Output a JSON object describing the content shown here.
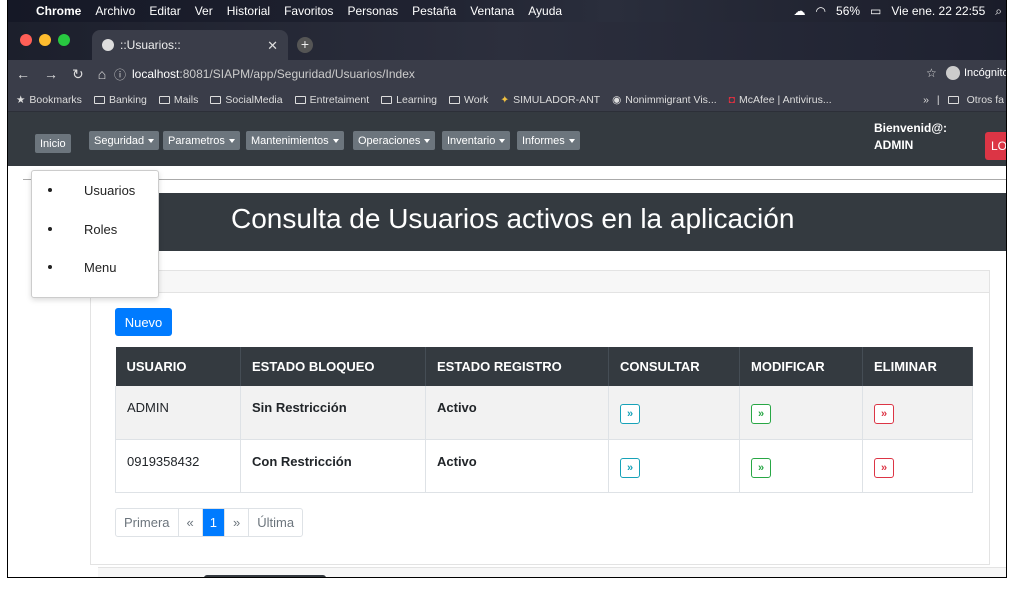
{
  "mac_menubar": {
    "app": "Chrome",
    "items": [
      "Archivo",
      "Editar",
      "Ver",
      "Historial",
      "Favoritos",
      "Personas",
      "Pestaña",
      "Ventana",
      "Ayuda"
    ],
    "battery": "56%",
    "datetime": "Vie ene. 22  22:55"
  },
  "browser": {
    "tab_title": "::Usuarios::",
    "url_host": "localhost",
    "url_rest": ":8081/SIAPM/app/Seguridad/Usuarios/Index",
    "profile": "Incógnito",
    "bookmarks": [
      {
        "label": "Bookmarks",
        "icon": "star-icon"
      },
      {
        "label": "Banking",
        "icon": "folder-icon"
      },
      {
        "label": "Mails",
        "icon": "folder-icon"
      },
      {
        "label": "SocialMedia",
        "icon": "folder-icon"
      },
      {
        "label": "Entretaiment",
        "icon": "folder-icon"
      },
      {
        "label": "Learning",
        "icon": "folder-icon"
      },
      {
        "label": "Work",
        "icon": "folder-icon"
      },
      {
        "label": "SIMULADOR-ANT",
        "icon": "site-icon"
      },
      {
        "label": "Nonimmigrant Vis...",
        "icon": "site-icon"
      },
      {
        "label": "McAfee | Antivirus...",
        "icon": "site-icon"
      }
    ],
    "bookmarks_more": "»",
    "other_bookmarks": "Otros fa"
  },
  "navbar": {
    "items": [
      {
        "label": "Inicio",
        "dropdown": false
      },
      {
        "label": "Seguridad",
        "dropdown": true
      },
      {
        "label": "Parametros",
        "dropdown": true
      },
      {
        "label": "Mantenimientos",
        "dropdown": true
      },
      {
        "label": "Operaciones",
        "dropdown": true
      },
      {
        "label": "Inventario",
        "dropdown": true
      },
      {
        "label": "Informes",
        "dropdown": true
      }
    ],
    "welcome_line1": "Bienvenid@:",
    "welcome_line2": "ADMIN",
    "logout_label": "LOG"
  },
  "dropdown_menu": {
    "items": [
      "Usuarios",
      "Roles",
      "Menu"
    ]
  },
  "page": {
    "title": "Consulta de Usuarios activos en la aplicación",
    "new_button": "Nuevo"
  },
  "table": {
    "headers": [
      "USUARIO",
      "ESTADO BLOQUEO",
      "ESTADO REGISTRO",
      "CONSULTAR",
      "MODIFICAR",
      "ELIMINAR"
    ],
    "rows": [
      {
        "usuario": "ADMIN",
        "bloqueo": "Sin Restricción",
        "registro": "Activo"
      },
      {
        "usuario": "0919358432",
        "bloqueo": "Con Restricción",
        "registro": "Activo"
      }
    ],
    "action_glyph": "»"
  },
  "pagination": {
    "first": "Primera",
    "prev": "«",
    "current": "1",
    "next": "»",
    "last": "Última"
  },
  "colors": {
    "navbar": "#343a40",
    "primary": "#007bff",
    "info": "#17a2b8",
    "success": "#28a745",
    "danger": "#dc3545"
  }
}
